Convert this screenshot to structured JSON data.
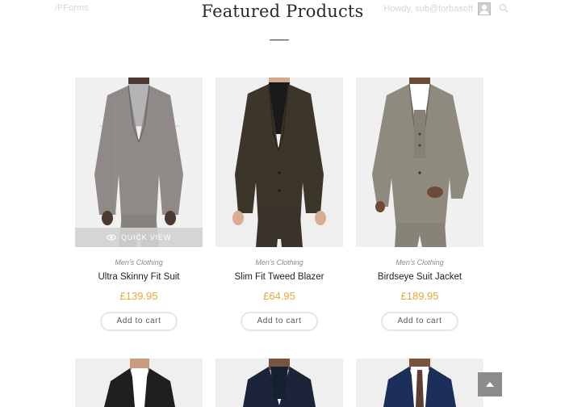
{
  "topbar": {
    "site_name": "/PForms",
    "greeting": "Howdy, sub@torbasoft"
  },
  "section": {
    "title": "Featured Products"
  },
  "products": [
    {
      "category": "Men's Clothing",
      "name": "Ultra Skinny Fit Suit",
      "price": "£139.95",
      "cta": "Add to cart",
      "quick_view": "QUICK VIEW"
    },
    {
      "category": "Men's Clothing",
      "name": "Slim Fit Tweed Blazer",
      "price": "£64.95",
      "cta": "Add to cart"
    },
    {
      "category": "Men's Clothing",
      "name": "Birdseye Suit Jacket",
      "price": "£189.95",
      "cta": "Add to cart"
    }
  ],
  "icons": {
    "search": "search-icon",
    "eye": "eye-icon",
    "scroll_top": "chevron-up-icon",
    "avatar": "avatar"
  },
  "colors": {
    "price": "#e5a93a",
    "scroll_button": "#8c8c8c"
  }
}
